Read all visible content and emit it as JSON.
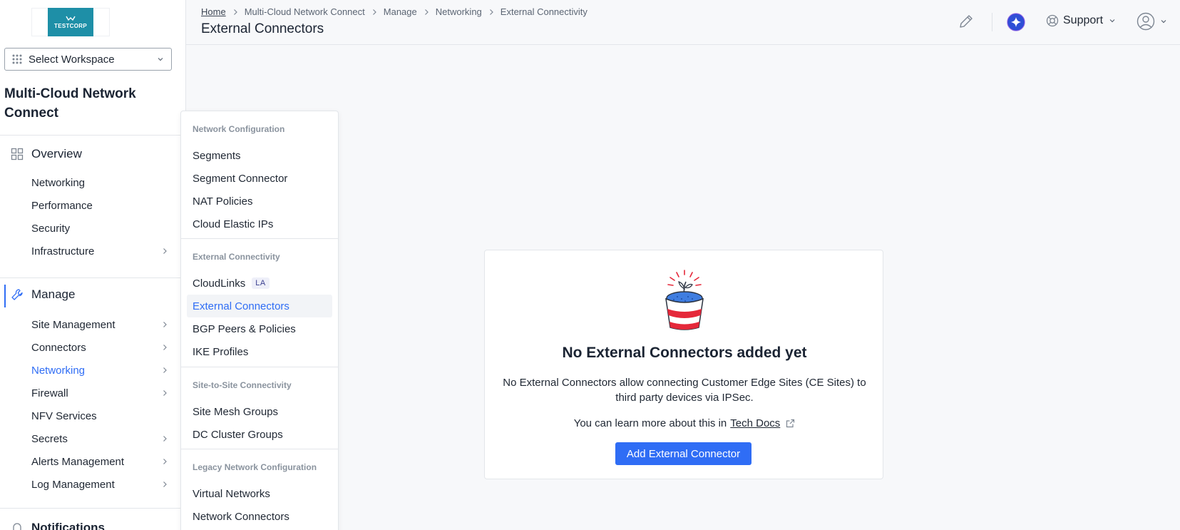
{
  "logo": {
    "text": "TESTCORP"
  },
  "workspace": {
    "label": "Select Workspace"
  },
  "app_title": "Multi-Cloud Network Connect",
  "nav": {
    "overview": {
      "label": "Overview",
      "items": [
        {
          "label": "Networking",
          "has_arrow": false
        },
        {
          "label": "Performance",
          "has_arrow": false
        },
        {
          "label": "Security",
          "has_arrow": false
        },
        {
          "label": "Infrastructure",
          "has_arrow": true
        }
      ]
    },
    "manage": {
      "label": "Manage",
      "items": [
        {
          "label": "Site Management",
          "has_arrow": true
        },
        {
          "label": "Connectors",
          "has_arrow": true
        },
        {
          "label": "Networking",
          "has_arrow": true,
          "selected": true
        },
        {
          "label": "Firewall",
          "has_arrow": true
        },
        {
          "label": "NFV Services",
          "has_arrow": false
        },
        {
          "label": "Secrets",
          "has_arrow": true
        },
        {
          "label": "Alerts Management",
          "has_arrow": true
        },
        {
          "label": "Log Management",
          "has_arrow": true
        }
      ]
    },
    "notifications": {
      "label": "Notifications"
    }
  },
  "breadcrumb": [
    "Home",
    "Multi-Cloud Network Connect",
    "Manage",
    "Networking",
    "External Connectivity"
  ],
  "page_title": "External Connectors",
  "header": {
    "support_label": "Support"
  },
  "flyout": {
    "groups": [
      {
        "title": "Network Configuration",
        "items": [
          "Segments",
          "Segment Connector",
          "NAT Policies",
          "Cloud Elastic IPs"
        ]
      },
      {
        "title": "External Connectivity",
        "items": [
          "CloudLinks",
          "External Connectors",
          "BGP Peers & Policies",
          "IKE Profiles"
        ]
      },
      {
        "title": "Site-to-Site Connectivity",
        "items": [
          "Site Mesh Groups",
          "DC Cluster Groups"
        ]
      },
      {
        "title": "Legacy Network Configuration",
        "items": [
          "Virtual Networks",
          "Network Connectors"
        ]
      }
    ],
    "badge": "LA",
    "selected": "External Connectors"
  },
  "empty_state": {
    "title": "No External Connectors added yet",
    "description": "No External Connectors allow connecting Customer Edge Sites (CE Sites) to third party devices via IPSec.",
    "learn_prefix": "You can learn more about this in",
    "learn_link": "Tech Docs",
    "button_label": "Add External Connector"
  },
  "colors": {
    "accent": "#2f6df5",
    "logo_bg": "#1e8fa7",
    "pot_red": "#e5283a",
    "pot_blue": "#3f7de0"
  }
}
